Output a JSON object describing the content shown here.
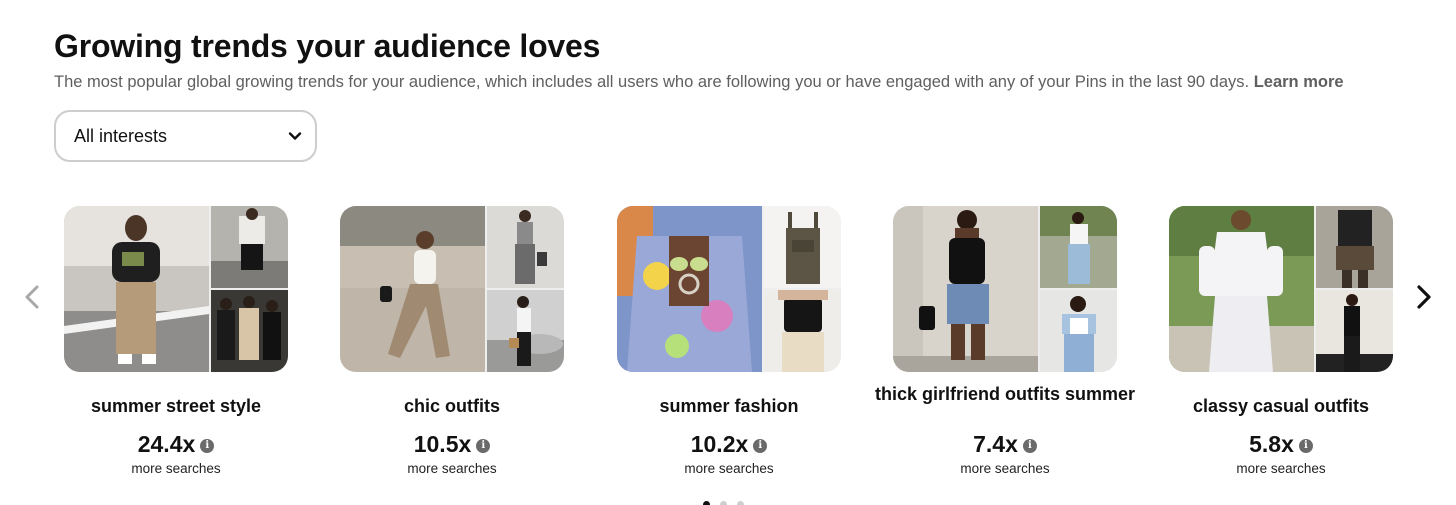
{
  "header": {
    "title": "Growing trends your audience loves",
    "subtitle": "The most popular global growing trends for your audience, which includes all users who are following you or have engaged with any of your Pins in the last 90 days.",
    "learn_more": "Learn more"
  },
  "filter": {
    "selected": "All interests"
  },
  "icons": {
    "prev": "chevron-left-icon",
    "next": "chevron-right-icon",
    "dropdown": "chevron-down-icon",
    "info": "info-icon"
  },
  "trends": [
    {
      "label": "summer street style",
      "multiplier": "24.4x",
      "caption": "more searches"
    },
    {
      "label": "chic outfits",
      "multiplier": "10.5x",
      "caption": "more searches"
    },
    {
      "label": "summer fashion",
      "multiplier": "10.2x",
      "caption": "more searches"
    },
    {
      "label": "thick girlfriend outfits summer",
      "multiplier": "7.4x",
      "caption": "more searches"
    },
    {
      "label": "classy casual outfits",
      "multiplier": "5.8x",
      "caption": "more searches"
    }
  ],
  "pagination": {
    "pages": 3,
    "current": 1
  }
}
